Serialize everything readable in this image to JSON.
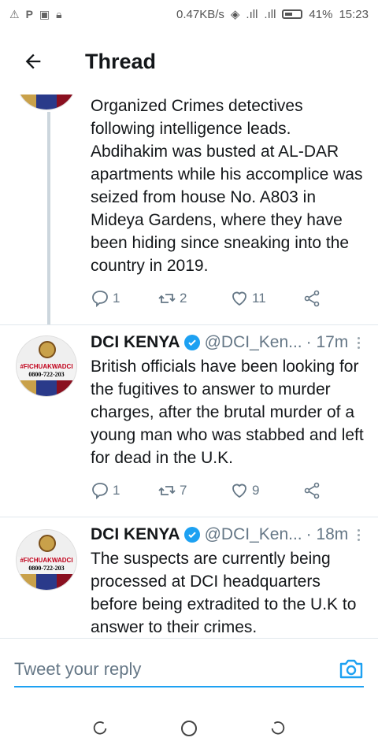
{
  "status_bar": {
    "left_icons": [
      "warning-icon",
      "parking-icon",
      "image-icon",
      "lock-icon"
    ],
    "speed": "0.47KB/s",
    "battery": "41%",
    "time": "15:23"
  },
  "header": {
    "title": "Thread"
  },
  "tweets": [
    {
      "text": "Organized Crimes detectives following intelligence leads. Abdihakim was busted at AL-DAR apartments while his accomplice was seized from house No. A803 in Mideya Gardens, where they have been hiding since sneaking into the country in 2019.",
      "replies": "1",
      "retweets": "2",
      "likes": "11"
    },
    {
      "name": "DCI KENYA",
      "handle": "@DCI_Ken...",
      "time": "· 17m",
      "text": "British officials have been looking for the fugitives to answer to murder charges, after the brutal murder of a young man who was stabbed and left for dead in the U.K.",
      "replies": "1",
      "retweets": "7",
      "likes": "9"
    },
    {
      "name": "DCI KENYA",
      "handle": "@DCI_Ken...",
      "time": "· 18m",
      "text": "The suspects are currently being processed at DCI headquarters before being extradited to the U.K to answer to their crimes."
    }
  ],
  "avatar": {
    "tag": "#FICHUAKWADCI",
    "phone": "0800-722-203"
  },
  "reply": {
    "placeholder": "Tweet your reply"
  },
  "colors": {
    "accent": "#1da1f2",
    "muted": "#657786",
    "text": "#14171a"
  }
}
